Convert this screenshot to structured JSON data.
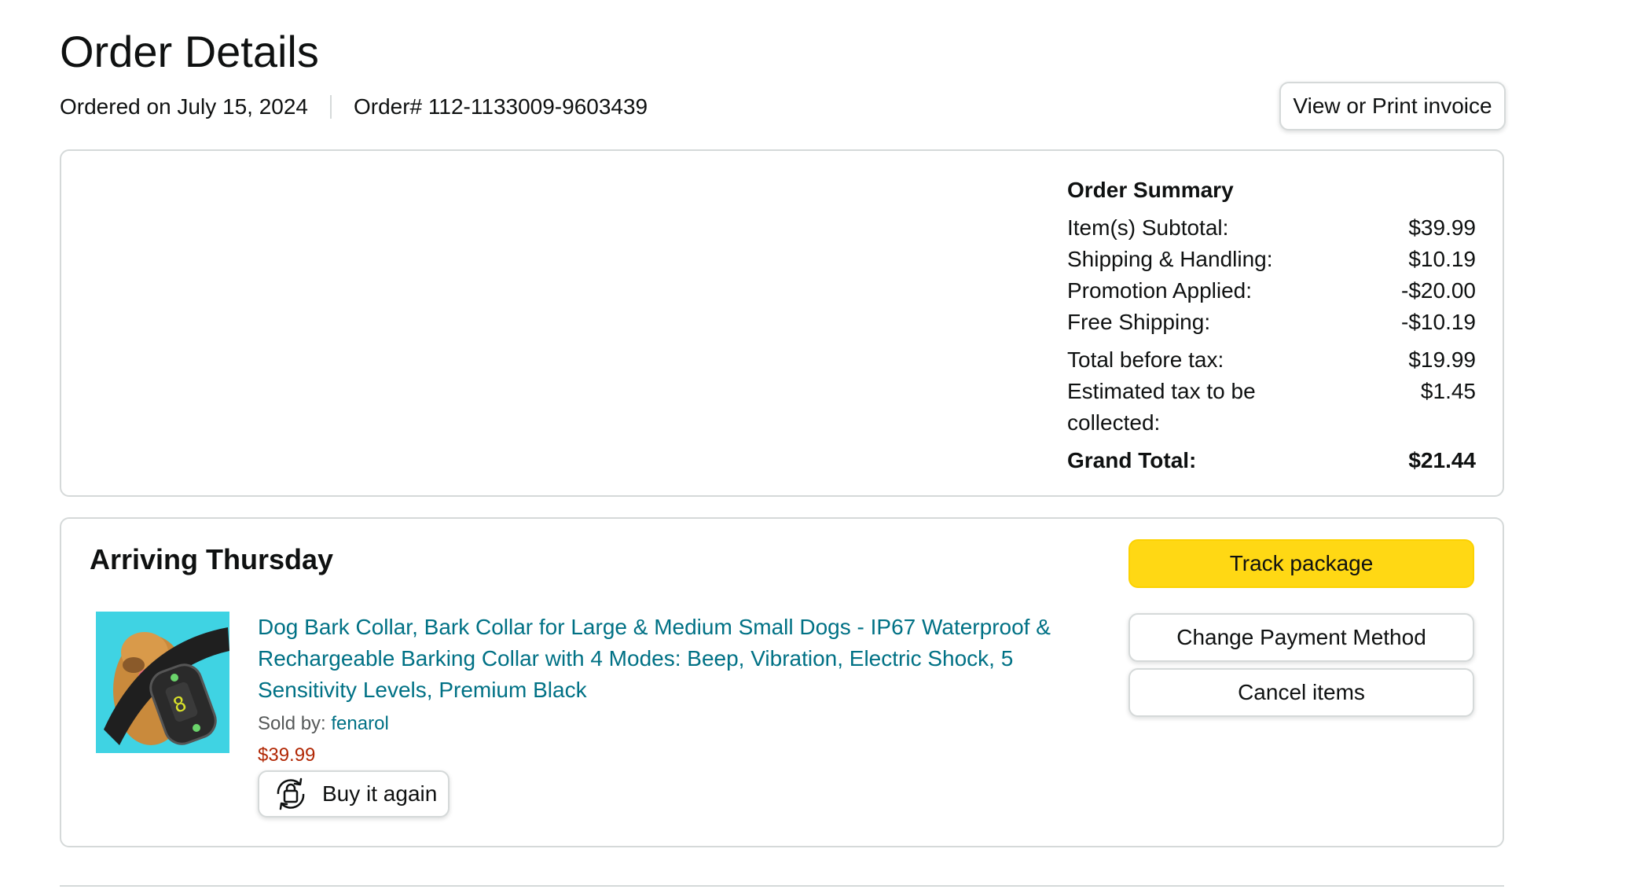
{
  "page": {
    "title": "Order Details",
    "ordered_on": "Ordered on July 15, 2024",
    "order_number": "Order# 112-1133009-9603439",
    "invoice_button": "View or Print invoice"
  },
  "order_summary": {
    "title": "Order Summary",
    "rows": [
      {
        "label": "Item(s) Subtotal:",
        "value": "$39.99"
      },
      {
        "label": "Shipping & Handling:",
        "value": "$10.19"
      },
      {
        "label": "Promotion Applied:",
        "value": "-$20.00"
      },
      {
        "label": "Free Shipping:",
        "value": "-$10.19"
      },
      {
        "label": "Total before tax:",
        "value": "$19.99"
      },
      {
        "label": "Estimated tax to be collected:",
        "value": "$1.45"
      }
    ],
    "grand_total_label": "Grand Total:",
    "grand_total_value": "$21.44"
  },
  "shipment": {
    "status": "Arriving Thursday",
    "product": {
      "title": "Dog Bark Collar, Bark Collar for Large & Medium Small Dogs - IP67 Waterproof & Rechargeable Barking Collar with 4 Modes: Beep, Vibration, Electric Shock, 5 Sensitivity Levels, Premium Black",
      "sold_by_label": "Sold by: ",
      "seller": "fenarol",
      "price": "$39.99",
      "buy_again_label": "Buy it again",
      "image_icon": "dog-collar-product-image"
    },
    "actions": {
      "track": "Track package",
      "change_payment": "Change Payment Method",
      "cancel": "Cancel items"
    }
  },
  "colors": {
    "link": "#007185",
    "price": "#b12704",
    "primary_button": "#ffd814",
    "border": "#d5d9d9"
  }
}
